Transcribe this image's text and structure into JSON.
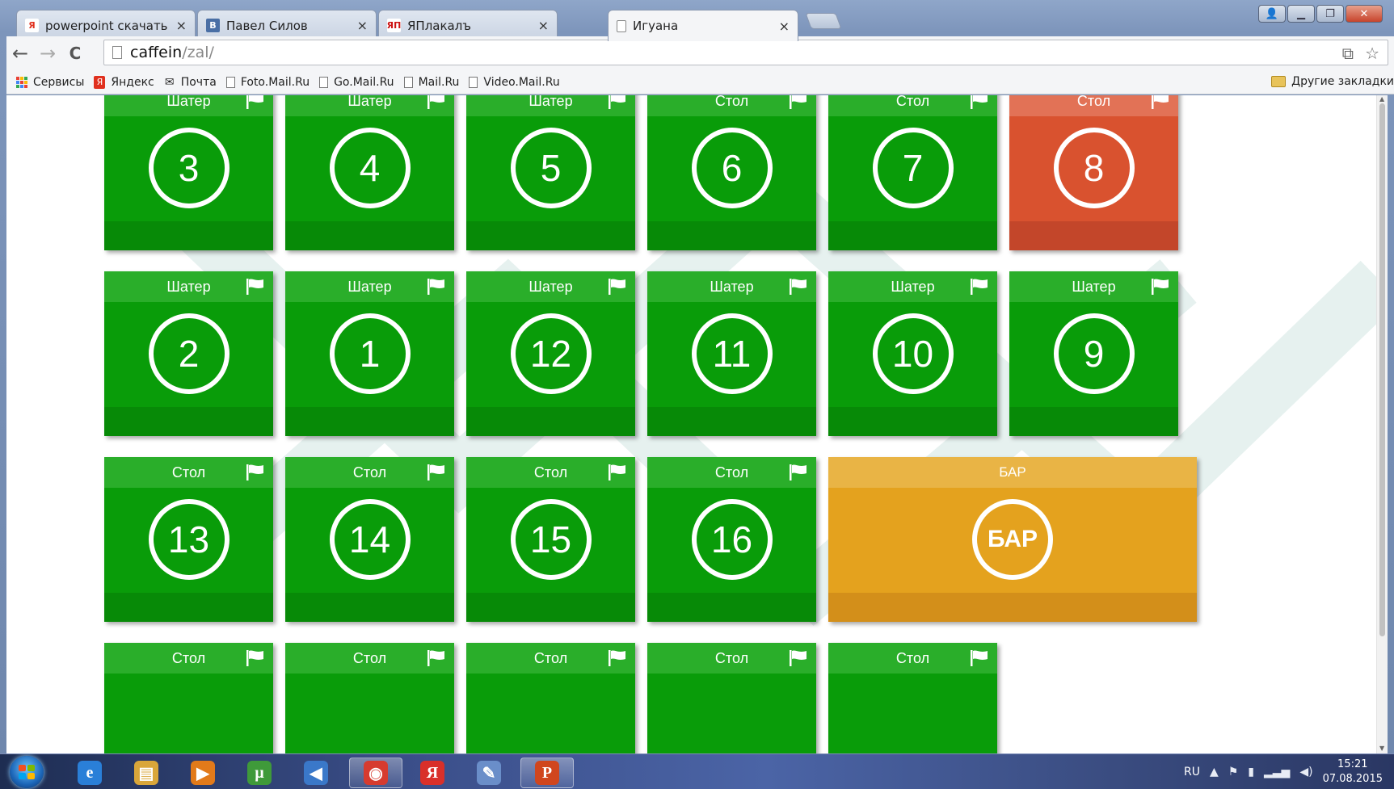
{
  "browser": {
    "tabs": [
      {
        "label": "powerpoint скачать бесп",
        "favicon": "Я",
        "favicon_color": "#ffffff",
        "favicon_text_color": "#e0301e",
        "active": false
      },
      {
        "label": "Павел Силов",
        "favicon": "В",
        "favicon_color": "#4a6fa5",
        "favicon_text_color": "#ffffff",
        "active": false
      },
      {
        "label": "ЯПлакалъ",
        "favicon": "ЯП",
        "favicon_color": "#ffffff",
        "favicon_text_color": "#cc1111",
        "active": false
      },
      {
        "label": "Игуана",
        "favicon": "",
        "favicon_color": "#ffffff",
        "favicon_text_color": "#333333",
        "active": true
      }
    ],
    "close_glyph": "×",
    "window_buttons": {
      "user": "👤",
      "minimize": "▁",
      "maximize": "❐",
      "close": "✕"
    },
    "nav": {
      "back": "←",
      "forward": "→",
      "reload": "C"
    },
    "url_host": "caffein",
    "url_path": "/zal/",
    "bookmarks": [
      {
        "label": "Сервисы",
        "icon": "apps-icon"
      },
      {
        "label": "Яндекс",
        "icon": "yandex-icon"
      },
      {
        "label": "Почта",
        "icon": "mail-icon"
      },
      {
        "label": "Foto.Mail.Ru",
        "icon": "page-icon"
      },
      {
        "label": "Go.Mail.Ru",
        "icon": "page-icon"
      },
      {
        "label": "Mail.Ru",
        "icon": "page-icon"
      },
      {
        "label": "Video.Mail.Ru",
        "icon": "page-icon"
      }
    ],
    "other_bookmarks": "Другие закладки"
  },
  "tiles": [
    {
      "type": "Шатер",
      "number": "3",
      "status": "free"
    },
    {
      "type": "Шатер",
      "number": "4",
      "status": "free"
    },
    {
      "type": "Шатер",
      "number": "5",
      "status": "free"
    },
    {
      "type": "Стол",
      "number": "6",
      "status": "free"
    },
    {
      "type": "Стол",
      "number": "7",
      "status": "free"
    },
    {
      "type": "Стол",
      "number": "8",
      "status": "busy"
    },
    {
      "type": "Шатер",
      "number": "2",
      "status": "free"
    },
    {
      "type": "Шатер",
      "number": "1",
      "status": "free"
    },
    {
      "type": "Шатер",
      "number": "12",
      "status": "free"
    },
    {
      "type": "Шатер",
      "number": "11",
      "status": "free"
    },
    {
      "type": "Шатер",
      "number": "10",
      "status": "free"
    },
    {
      "type": "Шатер",
      "number": "9",
      "status": "free"
    },
    {
      "type": "Стол",
      "number": "13",
      "status": "free"
    },
    {
      "type": "Стол",
      "number": "14",
      "status": "free"
    },
    {
      "type": "Стол",
      "number": "15",
      "status": "free"
    },
    {
      "type": "Стол",
      "number": "16",
      "status": "free"
    },
    {
      "type": "БАР",
      "number": "БАР",
      "status": "bar"
    },
    {
      "type": "Стол",
      "number": "",
      "status": "free"
    },
    {
      "type": "Стол",
      "number": "",
      "status": "free"
    },
    {
      "type": "Стол",
      "number": "",
      "status": "free"
    },
    {
      "type": "Стол",
      "number": "",
      "status": "free"
    },
    {
      "type": "Стол",
      "number": "",
      "status": "free"
    }
  ],
  "colors": {
    "free": "#099c09",
    "busy": "#d9522f",
    "bar": "#e4a21e"
  },
  "taskbar": {
    "apps": [
      {
        "name": "ie-icon",
        "glyph": "e",
        "color": "#2a7fd8",
        "running": false
      },
      {
        "name": "explorer-icon",
        "glyph": "▤",
        "color": "#d9a63a",
        "running": false
      },
      {
        "name": "media-player-icon",
        "glyph": "▶",
        "color": "#e27a1a",
        "running": false
      },
      {
        "name": "utorrent-icon",
        "glyph": "µ",
        "color": "#3f9a3a",
        "running": false
      },
      {
        "name": "sound-app-icon",
        "glyph": "◀",
        "color": "#3a78c9",
        "running": false
      },
      {
        "name": "chrome-icon",
        "glyph": "◉",
        "color": "#d63b2f",
        "running": true
      },
      {
        "name": "yandex-browser-icon",
        "glyph": "Я",
        "color": "#d9302a",
        "running": false
      },
      {
        "name": "paint-icon",
        "glyph": "✎",
        "color": "#6a8ec9",
        "running": false
      },
      {
        "name": "powerpoint-icon",
        "glyph": "P",
        "color": "#d0461e",
        "running": true
      }
    ],
    "lang": "RU",
    "tray_icons": {
      "arrow": "▲",
      "flag": "⚑",
      "power": "▮",
      "signal": "▂▃▅",
      "volume": "◀)"
    },
    "time": "15:21",
    "date": "07.08.2015"
  }
}
